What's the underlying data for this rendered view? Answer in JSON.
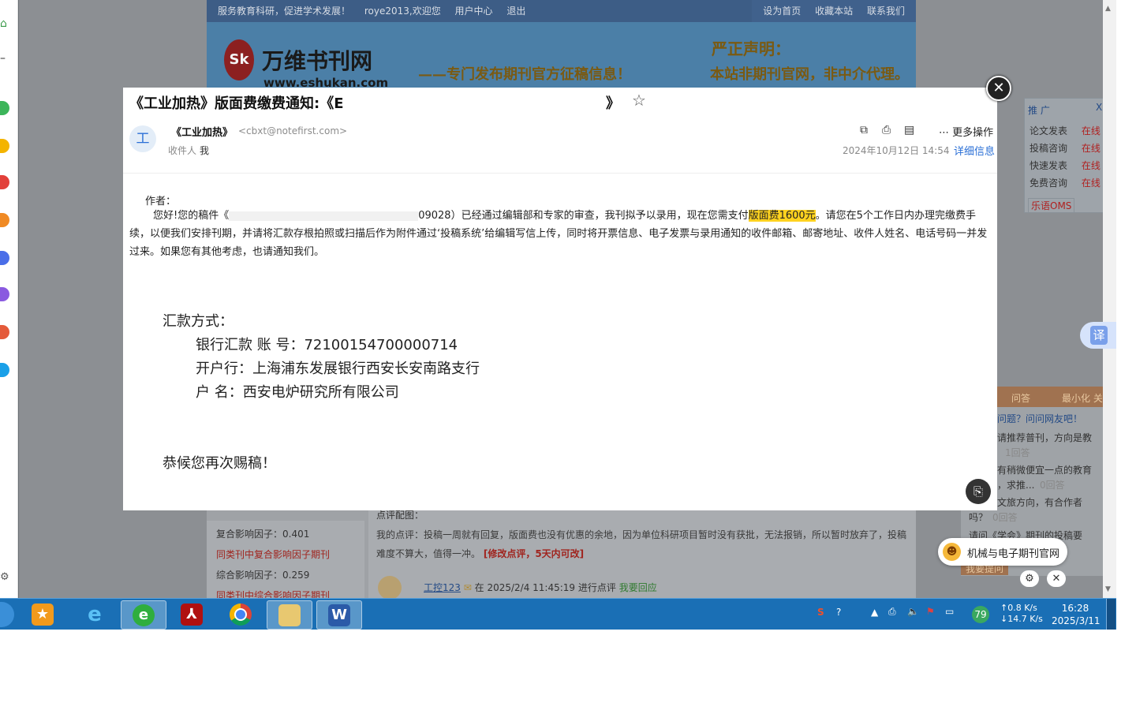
{
  "bg_site": {
    "topnav_left": [
      "服务教育科研，促进学术发展！",
      "roye2013,欢迎您",
      "用户中心",
      "退出"
    ],
    "topnav_right": [
      "设为首页",
      "收藏本站",
      "联系我们"
    ],
    "logo_mark": "Sk",
    "logo_name": "万维书刊网",
    "logo_url": "www.eshukan.com",
    "slogan": "——专门发布期刊官方征稿信息！",
    "notice_title": "严正声明：",
    "notice_text": "本站非期刊官网，非中介代理。",
    "left_items": [
      "复合影响因子：0.401",
      "同类刊中复合影响因子期刊",
      "综合影响因子：0.259",
      "同类刊中综合影响因子期刊"
    ],
    "review_label": "点评配图：",
    "review_text": "我的点评：投稿一周就有回复，版面费也没有优惠的余地，因为单位科研项目暂时没有获批，无法报销，所以暂时放弃了，投稿难度不算大，值得一冲。",
    "review_link": "[修改点评，5天内可改]",
    "review_user": "工控123",
    "review_time": "在 2025/2/4 11:45:19 进行点评",
    "review_reply": "我要回应",
    "promo_title": "推 广",
    "promo_close": "X",
    "promo_items": [
      {
        "label": "论文发表",
        "status": "在线"
      },
      {
        "label": "投稿咨询",
        "status": "在线"
      },
      {
        "label": "快速发表",
        "status": "在线"
      },
      {
        "label": "免费咨询",
        "status": "在线"
      }
    ],
    "promo_brand": "乐语OMS",
    "qa_head_left": "问答",
    "qa_head_right": "最小化 关",
    "qa_link": "问题？问问网友吧！",
    "qa_items": [
      "请推荐普刊，方向是教",
      "1回答",
      "有稍微便宜一点的教育",
      "，求推...",
      "0回答",
      "文旅方向，有合作者",
      "吗？",
      "0回答",
      "请问《学会》期刊的投稿要"
    ],
    "qa_btn": "我要提问"
  },
  "email": {
    "subject": "《工业加热》版面费缴费通知:《E",
    "subject_end": "》",
    "sender_name": "《工业加热》",
    "sender_email": "<cbxt@notefirst.com>",
    "avatar_letter": "工",
    "recipient_label": "收件人",
    "recipient": "我",
    "more_label": "更多操作",
    "date": "2024年10月12日 14:54",
    "detail_label": "详细信息",
    "greeting": "作者：",
    "body_pre": "您好!您的稿件《",
    "body_id": "09028）已经通过编辑部和专家的审查，我刊拟予以录用，现在您需支付",
    "body_fee": "版面费1600元",
    "body_post": "。请您在5个工作日内办理完缴费手续，以便我们安排刊期，并请将汇款存根拍照或扫描后作为附件通过‘投稿系统’给编辑写信上传，同时将开票信息、电子发票与录用通知的收件邮箱、邮寄地址、收件人姓名、电话号码一并发过来。如果您有其他考虑，也请通知我们。",
    "pay_title": "汇款方式：",
    "pay_account": "银行汇款 账 号：72100154700000714",
    "pay_bank": "开户行：上海浦东发展银行西安长安南路支行",
    "pay_name": "户 名：西安电炉研究所有限公司",
    "closing": "恭候您再次赐稿！"
  },
  "overlay": {
    "translate_label": "译",
    "bubble_text": "机械与电子期刊官网"
  },
  "taskbar": {
    "tray_temp": "79",
    "net_up": "↑0.8 K/s",
    "net_down": "↓14.7 K/s",
    "time": "16:28",
    "date": "2025/3/11"
  },
  "colors": {
    "highlight": "#ffd21f",
    "link": "#2a6fd6",
    "taskbar": "#1a6fb5"
  }
}
